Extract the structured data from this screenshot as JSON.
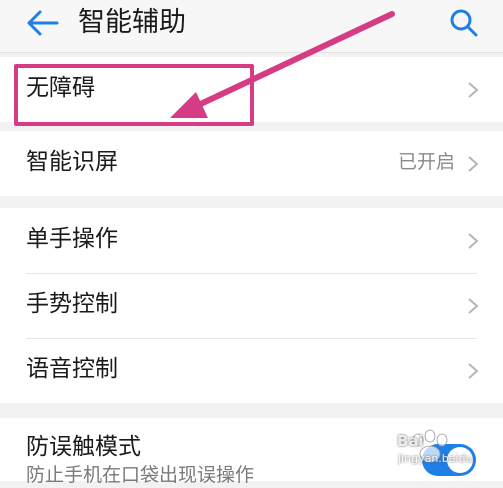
{
  "header": {
    "title": "智能辅助",
    "back_icon": "arrow-left-icon",
    "search_icon": "search-icon"
  },
  "colors": {
    "accent": "#1e7fe6",
    "annotation": "#d63c86"
  },
  "items": [
    {
      "label": "无障碍"
    },
    {
      "label": "智能识屏",
      "value": "已开启"
    },
    {
      "label": "单手操作"
    },
    {
      "label": "手势控制"
    },
    {
      "label": "语音控制"
    },
    {
      "label": "防误触模式",
      "sublabel": "防止手机在口袋出现误操作"
    }
  ],
  "watermark": {
    "brand": "Bai",
    "sub": "jingyan.baidu"
  }
}
